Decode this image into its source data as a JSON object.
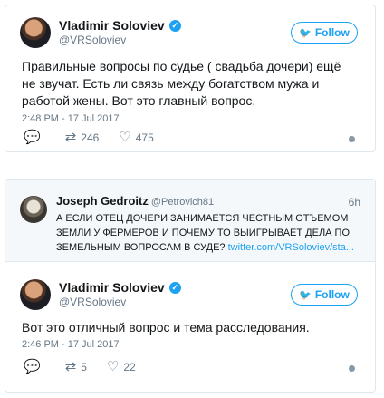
{
  "tweet1": {
    "display_name": "Vladimir Soloviev",
    "handle": "@VRSoloviev",
    "follow_label": "Follow",
    "text": "Правильные вопросы по судье ( свадьба дочери) ещё не звучат. Есть ли связь между богатством мужа и работой жены. Вот это главный вопрос.",
    "timestamp": "2:48 PM - 17 Jul 2017",
    "retweets": "246",
    "likes": "475"
  },
  "quoted": {
    "display_name": "Joseph Gedroitz",
    "handle": "@Petrovich81",
    "age": "6h",
    "text": "А ЕСЛИ ОТЕЦ ДОЧЕРИ ЗАНИМАЕТСЯ ЧЕСТНЫМ ОТЪЕМОМ ЗЕМЛИ У ФЕРМЕРОВ И ПОЧЕМУ ТО ВЫИГРЫВАЕТ ДЕЛА ПО ЗЕМЕЛЬНЫМ ВОПРОСАМ В СУДЕ? ",
    "link": "twitter.com/VRSoloviev/sta..."
  },
  "tweet2": {
    "display_name": "Vladimir Soloviev",
    "handle": "@VRSoloviev",
    "follow_label": "Follow",
    "text": "Вот это отличный вопрос и тема расследования.",
    "timestamp": "2:46 PM - 17 Jul 2017",
    "retweets": "5",
    "likes": "22"
  },
  "colors": {
    "accent": "#1da1f2",
    "muted": "#657786",
    "border": "#e1e8ed"
  },
  "icons": {
    "reply": "reply-icon",
    "retweet": "retweet-icon",
    "like": "heart-icon",
    "info": "info-icon",
    "bird": "twitter-bird-icon",
    "verified": "verified-badge-icon"
  }
}
